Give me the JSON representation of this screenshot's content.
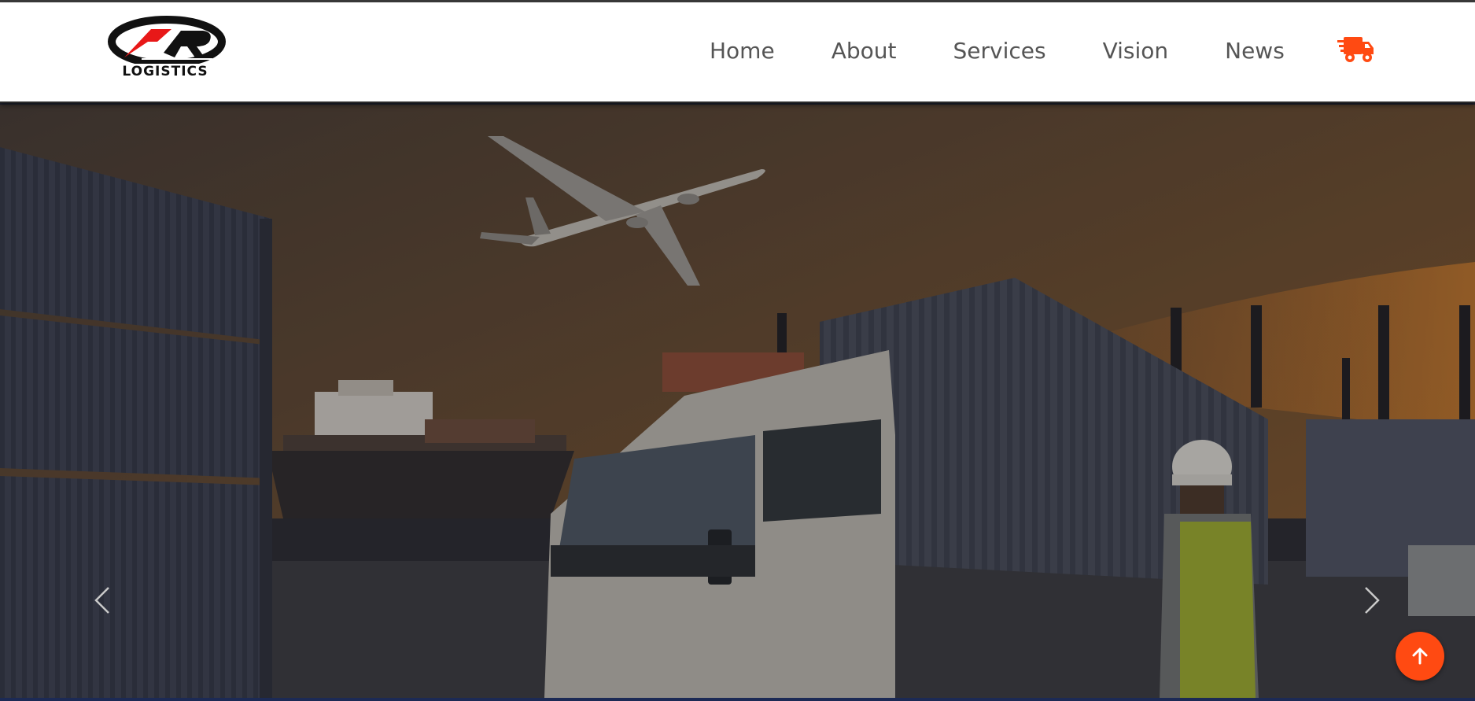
{
  "brand": {
    "logo_text": "LOGISTICS",
    "logo_icon": "ar-logo-icon",
    "accent_color": "#ff4a12"
  },
  "nav": {
    "items": [
      {
        "label": "Home"
      },
      {
        "label": "About"
      },
      {
        "label": "Services"
      },
      {
        "label": "Vision"
      },
      {
        "label": "News"
      }
    ],
    "cart_icon": "delivery-truck-icon"
  },
  "hero": {
    "prev_icon": "chevron-left-icon",
    "next_icon": "chevron-right-icon",
    "image_subject": "cargo-port-scene"
  },
  "scroll_top": {
    "icon": "arrow-up-icon"
  }
}
